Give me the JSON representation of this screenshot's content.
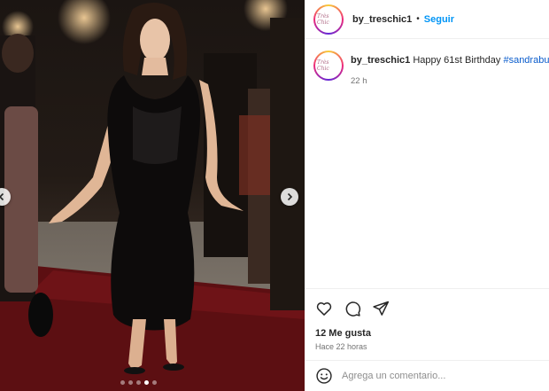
{
  "post": {
    "image_alt": "Woman in a black satin dress on a red carpet",
    "carousel": {
      "total_slides": 5,
      "active_slide": 4
    }
  },
  "header": {
    "username": "by_treschic1",
    "separator": "•",
    "follow_label": "Seguir",
    "avatar_text": "Très Chic"
  },
  "caption": {
    "username": "by_treschic1",
    "text": "Happy 61st Birthday",
    "hashtag": "#sandrabullock",
    "time": "22 h"
  },
  "actions": {
    "like_icon": "heart-icon",
    "comment_icon": "comment-icon",
    "share_icon": "share-icon"
  },
  "stats": {
    "likes": "12 Me gusta",
    "posted": "Hace 22 horas"
  },
  "comment": {
    "placeholder": "Agrega un comentario..."
  },
  "colors": {
    "follow_blue": "#0095f6",
    "hashtag_blue": "#0a5ccc",
    "muted_text": "#737373",
    "divider": "#efefef"
  }
}
